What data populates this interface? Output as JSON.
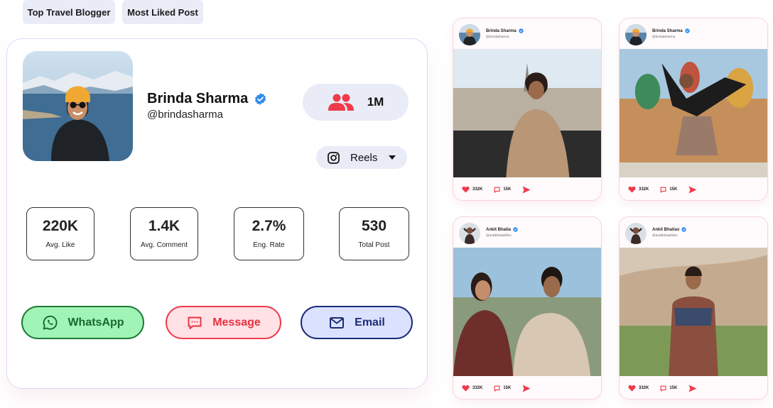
{
  "tags": [
    "Top Travel Blogger",
    "Most Liked Post"
  ],
  "profile": {
    "name": "Brinda Sharma",
    "handle": "@brindasharma",
    "verified": true,
    "followers": "1M",
    "platform": {
      "icon": "instagram-icon",
      "selected": "Reels"
    }
  },
  "stats": [
    {
      "value": "220K",
      "label": "Avg. Like"
    },
    {
      "value": "1.4K",
      "label": "Avg. Comment"
    },
    {
      "value": "2.7%",
      "label": "Eng. Rate"
    },
    {
      "value": "530",
      "label": "Total Post"
    }
  ],
  "actions": {
    "whatsapp": "WhatsApp",
    "message": "Message",
    "email": "Email"
  },
  "colors": {
    "accent_red": "#ee3b4a",
    "verified_blue": "#2f8cf0",
    "whatsapp_green": "#1f7a37",
    "email_navy": "#1c2b77"
  },
  "posts": [
    {
      "author": "Brinda Sharma",
      "handle": "@brindasharma",
      "likes": "332K",
      "comments": "15K"
    },
    {
      "author": "Brinda Sharma",
      "handle": "@brindasharma",
      "likes": "332K",
      "comments": "15K"
    },
    {
      "author": "Ankit Bhatia",
      "handle": "@ankitbhatiafilms",
      "likes": "332K",
      "comments": "15K"
    },
    {
      "author": "Ankit Bhatiav",
      "handle": "@ankitbhatiafilms",
      "likes": "332K",
      "comments": "15K"
    }
  ]
}
